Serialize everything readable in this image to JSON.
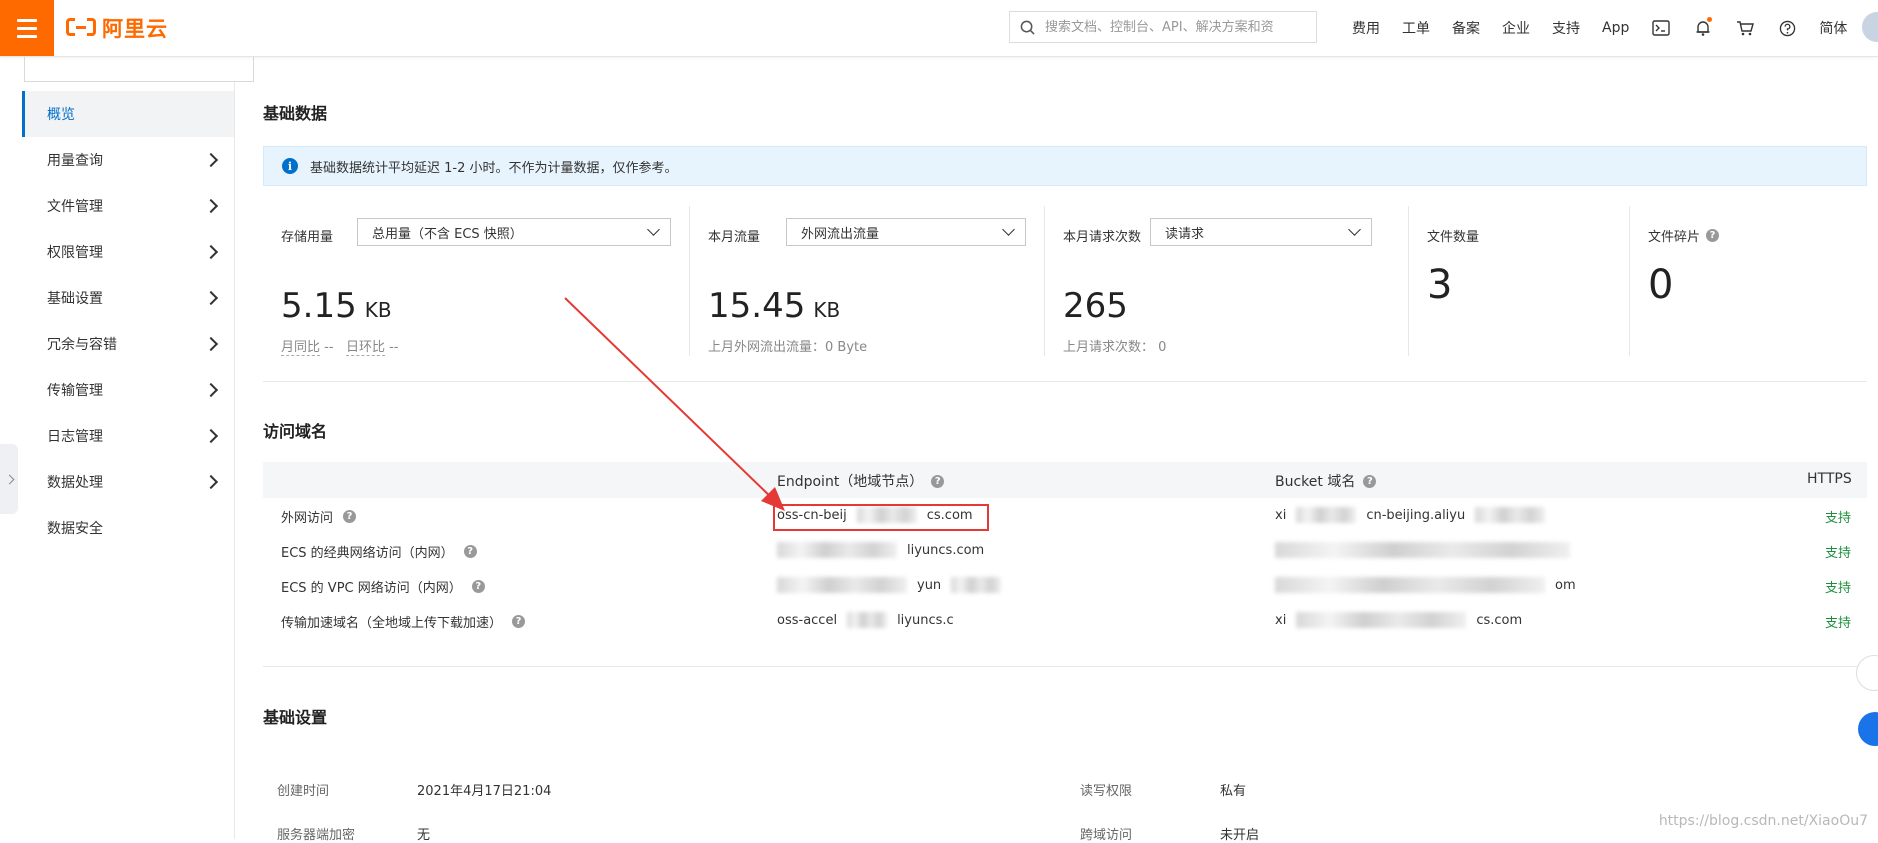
{
  "topbar": {
    "logo_text": "阿里云",
    "search_placeholder": "搜索文档、控制台、API、解决方案和资",
    "nav": [
      "费用",
      "工单",
      "备案",
      "企业",
      "支持",
      "App"
    ],
    "lang": "简体"
  },
  "sidebar": {
    "items": [
      {
        "label": "概览"
      },
      {
        "label": "用量查询"
      },
      {
        "label": "文件管理"
      },
      {
        "label": "权限管理"
      },
      {
        "label": "基础设置"
      },
      {
        "label": "冗余与容错"
      },
      {
        "label": "传输管理"
      },
      {
        "label": "日志管理"
      },
      {
        "label": "数据处理"
      },
      {
        "label": "数据安全"
      }
    ]
  },
  "basic_data": {
    "title": "基础数据",
    "notice": "基础数据统计平均延迟 1-2 小时。不作为计量数据，仅作参考。",
    "storage": {
      "label": "存储用量",
      "select": "总用量（不含 ECS 快照）",
      "value": "5.15",
      "unit": "KB",
      "yoy": "月同比",
      "yoy_val": "--",
      "mom": "日环比",
      "mom_val": "--"
    },
    "traffic": {
      "label": "本月流量",
      "select": "外网流出流量",
      "value": "15.45",
      "unit": "KB",
      "sub": "上月外网流出流量：0 Byte"
    },
    "requests": {
      "label": "本月请求次数",
      "select": "读请求",
      "value": "265",
      "sub": "上月请求次数：   0"
    },
    "files": {
      "label": "文件数量",
      "value": "3"
    },
    "fragments": {
      "label": "文件碎片",
      "value": "0"
    }
  },
  "domains": {
    "title": "访问域名",
    "headers": {
      "endpoint": "Endpoint（地域节点）",
      "bucket": "Bucket 域名",
      "https": "HTTPS"
    },
    "rows": [
      {
        "type": "外网访问",
        "endpoint": "oss-cn-beij",
        "endpoint_tail": "cs.com",
        "bucket": "xi",
        "bucket_tail": "cn-beijing.aliyu",
        "https": "支持"
      },
      {
        "type": "ECS 的经典网络访问（内网）",
        "endpoint": "",
        "endpoint_tail": "liyuncs.com",
        "bucket": "",
        "bucket_tail": "",
        "https": "支持"
      },
      {
        "type": "ECS 的 VPC 网络访问（内网）",
        "endpoint": "",
        "endpoint_tail": "yun",
        "bucket": "",
        "bucket_tail": "om",
        "https": "支持"
      },
      {
        "type": "传输加速域名（全地域上传下载加速）",
        "endpoint": "oss-accel",
        "endpoint_tail": "liyuncs.c",
        "bucket": "xi",
        "bucket_tail": "cs.com",
        "https": "支持"
      }
    ]
  },
  "settings": {
    "title": "基础设置",
    "created_label": "创建时间",
    "created_value": "2021年4月17日21:04",
    "encrypt_label": "服务器端加密",
    "encrypt_value": "无",
    "acl_label": "读写权限",
    "acl_value": "私有",
    "cors_label": "跨域访问",
    "cors_value": "未开启"
  },
  "watermark": "https://blog.csdn.net/XiaoOu7"
}
